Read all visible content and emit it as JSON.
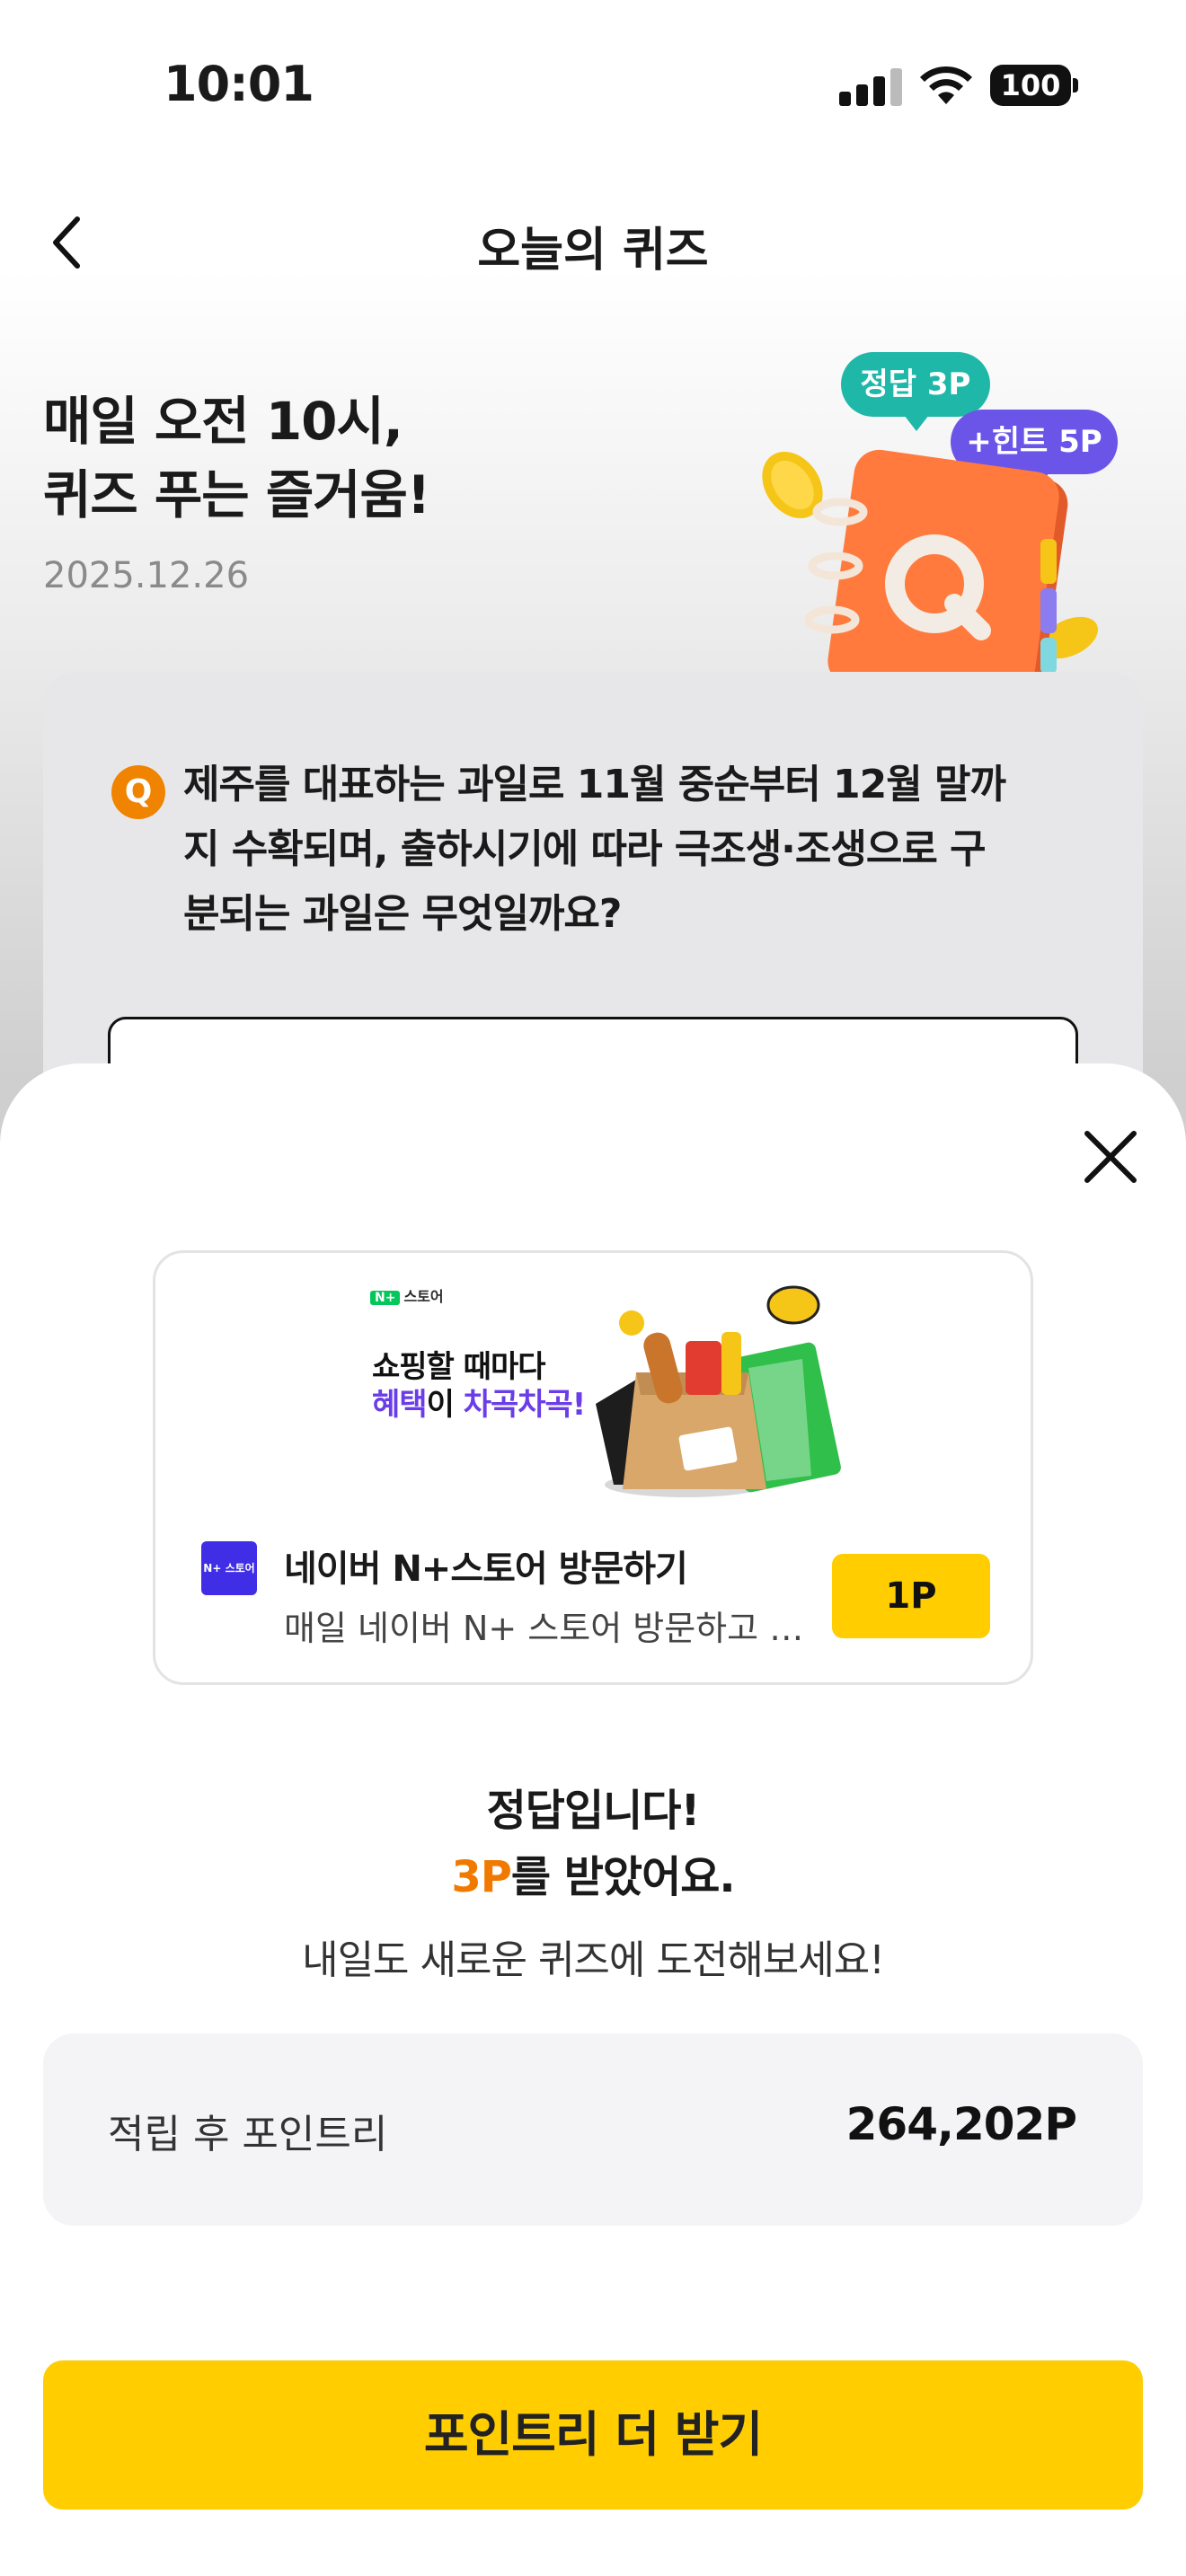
{
  "status_bar": {
    "time": "10:01",
    "battery": "100"
  },
  "nav": {
    "title": "오늘의 퀴즈"
  },
  "quiz": {
    "headline_line1": "매일 오전 10시,",
    "headline_line2": "퀴즈 푸는 즐거움!",
    "date": "2025.12.26",
    "badge_answer": "정답 3P",
    "badge_hint": "+힌트 5P",
    "question_marker": "Q",
    "question_line1": "제주를 대표하는 과일로 11월 중순부터 12월 말까",
    "question_line2": "지 수확되며, 출하시기에 따라 극조생·조생으로 구",
    "question_line3": "분되는 과일은 무엇일까요?"
  },
  "ad": {
    "store_logo": "스토어",
    "store_logo_mark": "N+",
    "tagline_1": "쇼핑할 때마다",
    "tagline_2a": "혜택",
    "tagline_2b": "이 ",
    "tagline_2c": "차곡차곡!",
    "icon_text": "N+ 스토어",
    "title": "네이버 N+스토어 방문하기",
    "description": "매일 네이버 N+ 스토어 방문하고 포인트 받기",
    "point_button": "1P"
  },
  "result": {
    "line1": "정답입니다!",
    "points_earned": "3P",
    "line2_suffix": "를 받았어요.",
    "subtitle": "내일도 새로운 퀴즈에 도전해보세요!"
  },
  "balance": {
    "label": "적립 후 포인트리",
    "value": "264,202P"
  },
  "cta": {
    "label": "포인트리 더 받기"
  },
  "colors": {
    "brand_yellow": "#ffcd00",
    "accent_orange": "#f07a00",
    "answer_badge": "#1fb7a8",
    "hint_badge": "#6a55e8",
    "ad_purple": "#6a3de8"
  }
}
